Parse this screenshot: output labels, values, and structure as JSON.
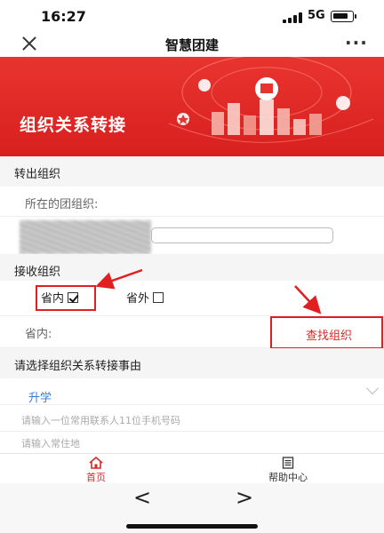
{
  "status_bar": {
    "time": "16:27",
    "network": "5G"
  },
  "nav": {
    "title": "智慧团建",
    "more": "···"
  },
  "banner": {
    "title": "组织关系转接"
  },
  "transfer_out": {
    "header": "转出组织",
    "field_label": "所在的团组织:"
  },
  "receive": {
    "header": "接收组织",
    "option_in_province": "省内",
    "option_out_province": "省外",
    "in_province_checked": true,
    "in_province_label": "省内:",
    "find_button": "查找组织"
  },
  "reason": {
    "header": "请选择组织关系转接事由",
    "selected": "升学",
    "hint_phone": "请输入一位常用联系人11位手机号码",
    "hint_address": "请输入常住地"
  },
  "tab_bar": {
    "home": "首页",
    "help": "帮助中心"
  },
  "browser": {
    "back": "<",
    "forward": ">"
  },
  "colors": {
    "brand_red": "#d72b27",
    "link_blue": "#3a7bd5",
    "annotation_red": "#e02020"
  }
}
